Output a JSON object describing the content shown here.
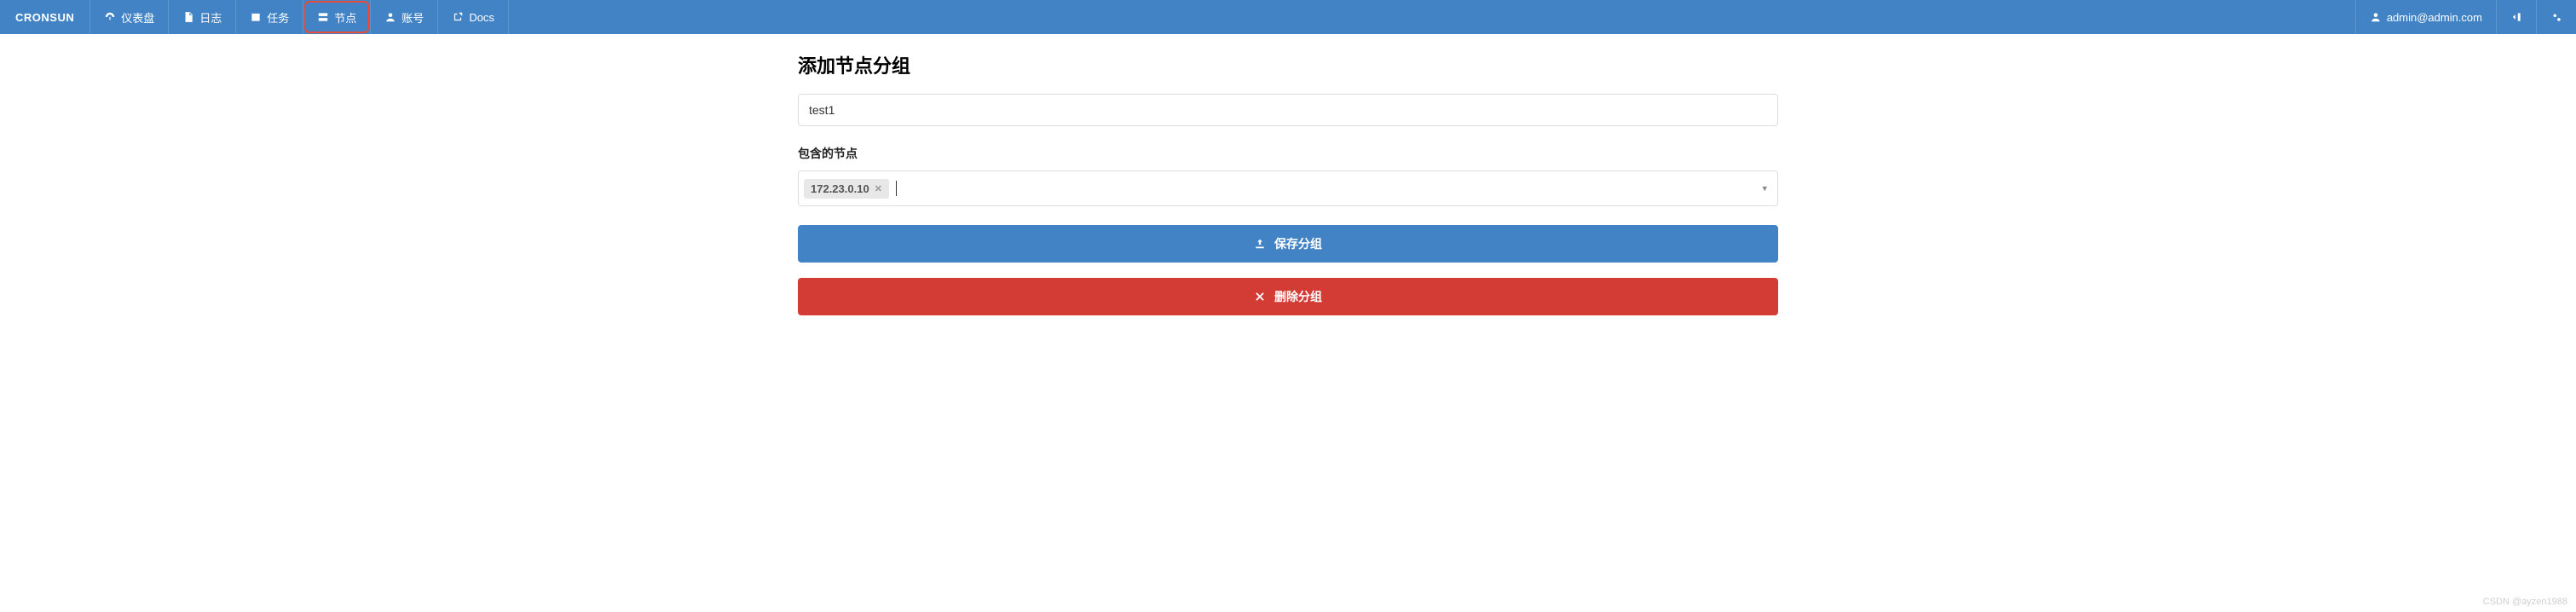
{
  "brand": "CRONSUN",
  "nav": {
    "items": [
      {
        "label": "仪表盘",
        "icon": "dashboard"
      },
      {
        "label": "日志",
        "icon": "file"
      },
      {
        "label": "任务",
        "icon": "calendar"
      },
      {
        "label": "节点",
        "icon": "server",
        "active": true
      },
      {
        "label": "账号",
        "icon": "user"
      },
      {
        "label": "Docs",
        "icon": "external"
      }
    ],
    "user_email": "admin@admin.com"
  },
  "main": {
    "title": "添加节点分组",
    "group_name_value": "test1",
    "contained_nodes_label": "包含的节点",
    "selected_nodes": [
      "172.23.0.10"
    ],
    "save_button": "保存分组",
    "delete_button": "删除分组"
  },
  "watermark": "CSDN @ayzen1988"
}
